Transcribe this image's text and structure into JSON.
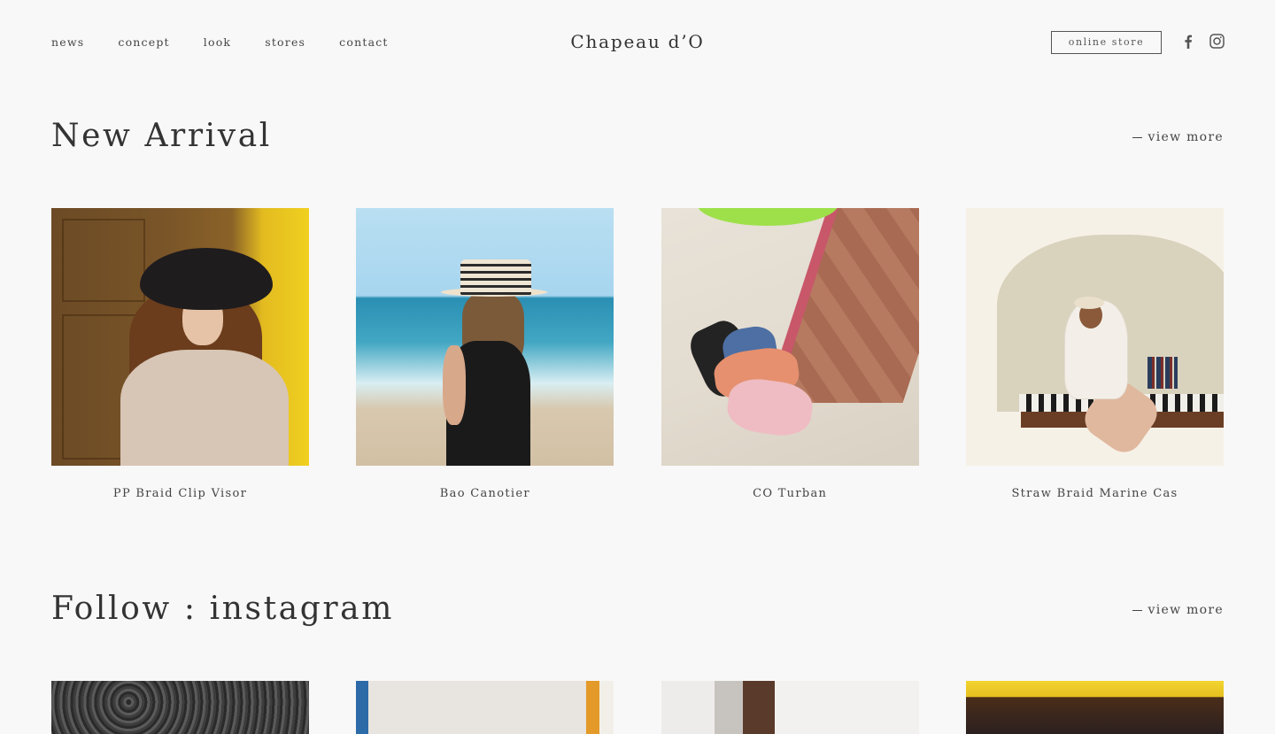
{
  "header": {
    "nav": [
      "news",
      "concept",
      "look",
      "stores",
      "contact"
    ],
    "logo": "Chapeau d’O",
    "online_store_label": "online store",
    "social": [
      "facebook-icon",
      "instagram-icon"
    ]
  },
  "new_arrival": {
    "title": "New Arrival",
    "view_more": "view more",
    "products": [
      {
        "name": "PP Braid Clip Visor"
      },
      {
        "name": "Bao Canotier"
      },
      {
        "name": "CO Turban"
      },
      {
        "name": "Straw Braid Marine Cas"
      }
    ]
  },
  "instagram": {
    "title": "Follow : instagram",
    "view_more": "view more"
  },
  "colors": {
    "background": "#f8f8f8",
    "text": "#333333",
    "border": "#555555"
  }
}
